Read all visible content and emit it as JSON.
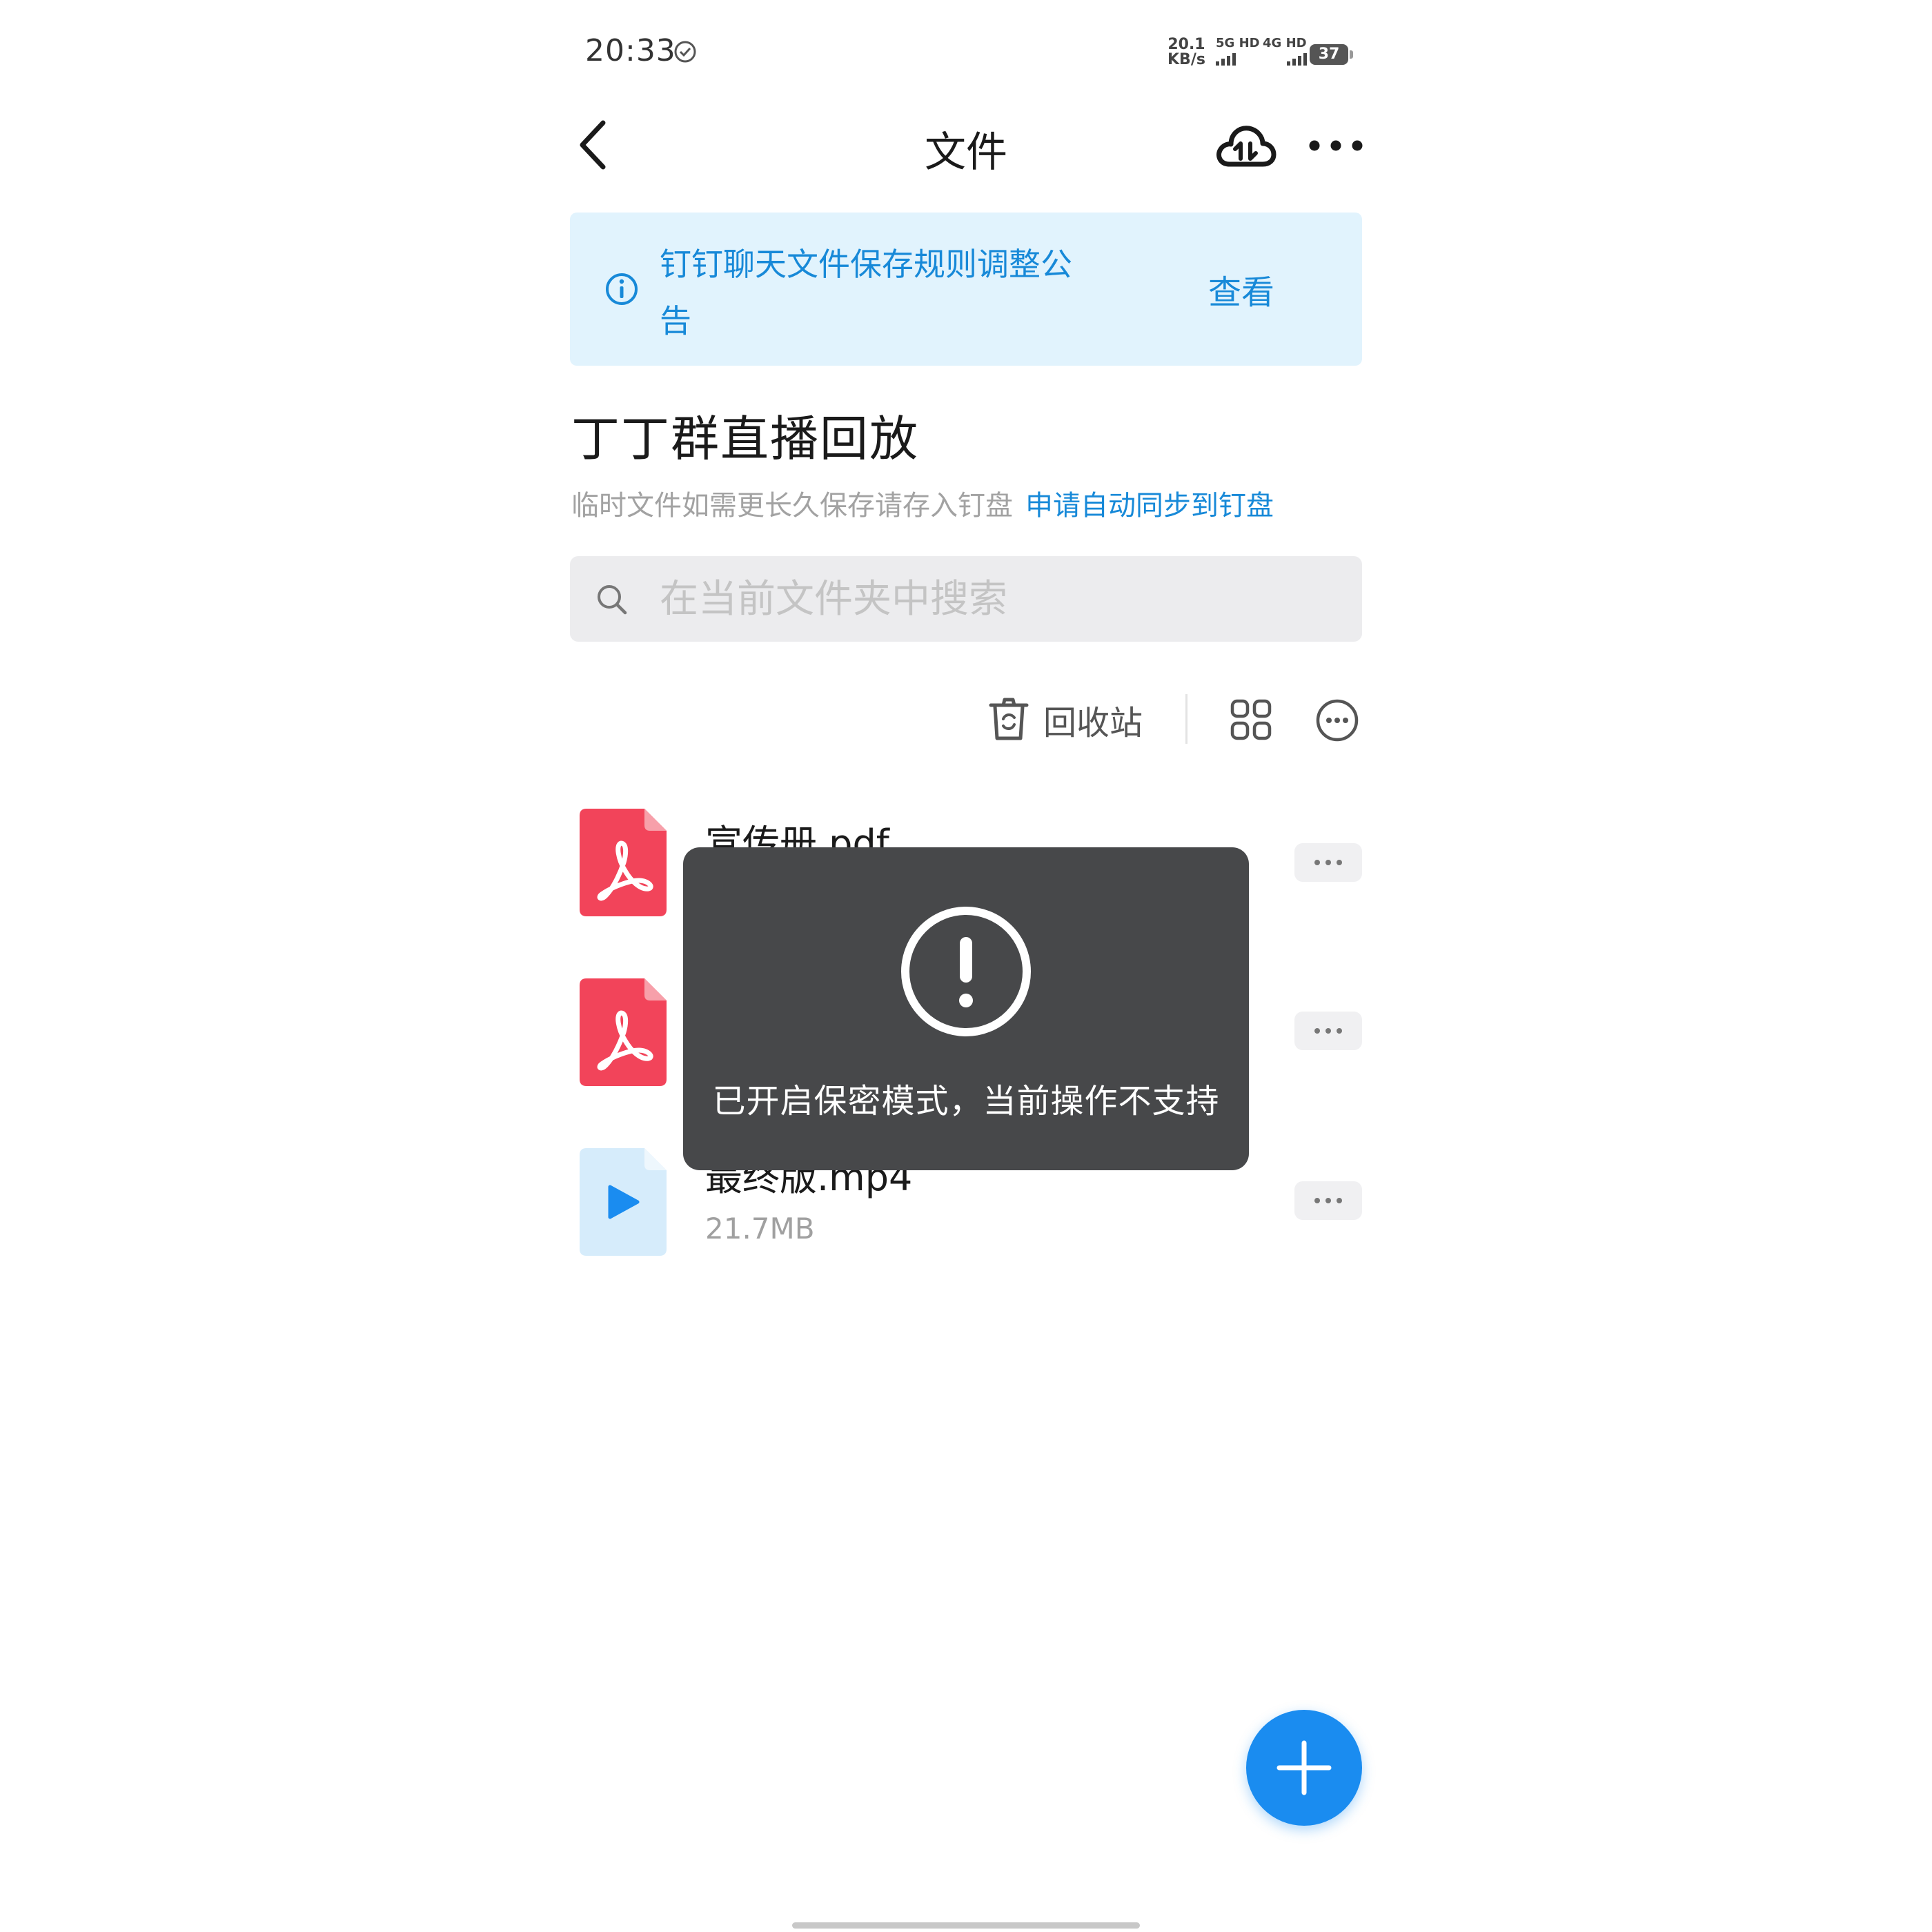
{
  "status_bar": {
    "time": "20:33",
    "net_speed_value": "20.1",
    "net_speed_unit": "KB/s",
    "sim1_label": "5G HD",
    "sim2_label": "4G HD",
    "battery": "37"
  },
  "nav": {
    "title": "文件",
    "back_icon": "chevron-left-icon",
    "cloud_icon": "cloud-transfer-icon",
    "more_icon": "more-horizontal-icon"
  },
  "notice": {
    "text": "钉钉聊天文件保存规则调整公告",
    "action": "查看"
  },
  "folder": {
    "title": "丁丁群直播回放",
    "subtitle": "临时文件如需更长久保存请存入钉盘",
    "sync_link": "申请自动同步到钉盘"
  },
  "search": {
    "placeholder": "在当前文件夹中搜索"
  },
  "toolbar": {
    "recycle_label": "回收站"
  },
  "files": [
    {
      "name": "宣传册.pdf",
      "size": "",
      "type": "pdf"
    },
    {
      "name": "",
      "size": "",
      "type": "pdf"
    },
    {
      "name": "最终版.mp4",
      "size": "21.7MB",
      "type": "video"
    }
  ],
  "toast": {
    "message": "已开启保密模式，当前操作不支持"
  },
  "colors": {
    "accent": "#1789d8",
    "fab": "#1a8cf0",
    "pdf": "#f2445a",
    "video_bg": "#d6ecfb",
    "video_play": "#1a8cf0",
    "notice_bg": "#e1f3fd",
    "toast_bg": "#47484a"
  }
}
